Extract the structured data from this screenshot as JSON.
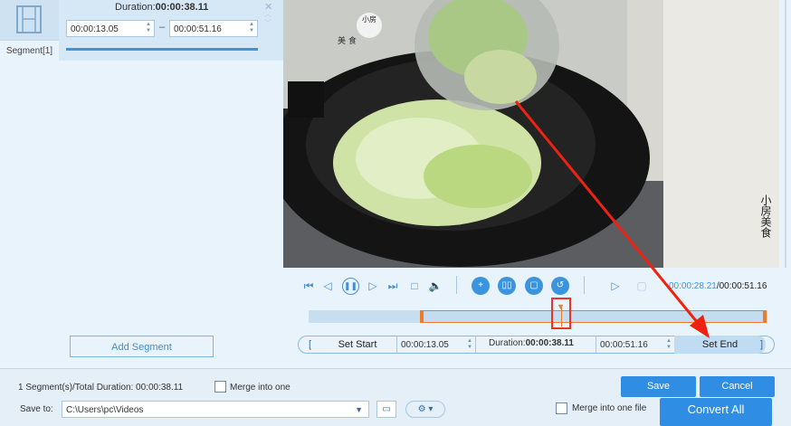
{
  "segment": {
    "duration_label": "Duration:",
    "duration_value": "00:00:38.11",
    "start": "00:00:13.05",
    "end": "00:00:51.16",
    "name": "Segment[1]",
    "dash": "–"
  },
  "left": {
    "add_segment": "Add Segment"
  },
  "player": {
    "current_time": "00:00:28.21",
    "total_time": "/00:00:51.16",
    "playhead_fraction": 0.556,
    "selection_start_fraction": 0.247,
    "selection_end_fraction": 1.0
  },
  "trim_bar": {
    "set_start": "Set Start",
    "start_value": "00:00:13.05",
    "duration_label": "Duration:",
    "duration_value": "00:00:38.11",
    "end_value": "00:00:51.16",
    "set_end": "Set End",
    "bracket_open": "[",
    "bracket_close": "]"
  },
  "footer": {
    "summary": "1 Segment(s)/Total Duration: 00:00:38.11",
    "merge_label": "Merge into one",
    "save": "Save",
    "cancel": "Cancel"
  },
  "back": {
    "save_to_label": "Save to:",
    "save_path": "C:\\Users\\pc\\Videos",
    "merge_label": "Merge into one file",
    "convert_all": "Convert All"
  },
  "video_overlay": {
    "logo_top": "小房",
    "logo_bottom": "美 食",
    "watermark": "小房美食"
  },
  "colors": {
    "accent": "#2f8de4",
    "highlight": "#ee3322",
    "selection_border": "#ee7a2b"
  }
}
